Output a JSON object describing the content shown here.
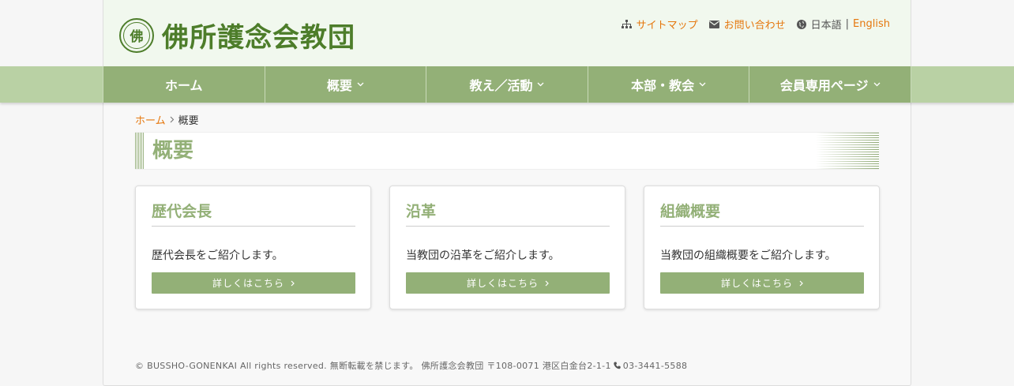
{
  "header": {
    "logo_seal": "佛",
    "logo_text": "佛所護念会教団",
    "links": {
      "sitemap": "サイトマップ",
      "contact": "お問い合わせ",
      "lang_ja": "日本語",
      "lang_sep": "|",
      "lang_en": "English"
    }
  },
  "nav": {
    "items": [
      {
        "label": "ホーム"
      },
      {
        "label": "概要"
      },
      {
        "label": "教え／活動"
      },
      {
        "label": "本部・教会"
      },
      {
        "label": "会員専用ページ"
      }
    ]
  },
  "breadcrumb": {
    "home": "ホーム",
    "current": "概要"
  },
  "page": {
    "title": "概要"
  },
  "cards": [
    {
      "title": "歴代会長",
      "text": "歴代会長をご紹介します。",
      "button": "詳しくはこちら"
    },
    {
      "title": "沿革",
      "text": "当教団の沿革をご紹介します。",
      "button": "詳しくはこちら"
    },
    {
      "title": "組織概要",
      "text": "当教団の組織概要をご紹介します。",
      "button": "詳しくはこちら"
    }
  ],
  "footer": {
    "copyright": "© BUSSHO-GONENKAI All rights reserved. 無断転載を禁じます。 佛所護念会教団 〒108-0071 港区白金台2-1-1",
    "phone": "03-3441-5588"
  },
  "colors": {
    "accent_green": "#93b077",
    "logo_green": "#4d7d2a",
    "link_orange": "#e5770d",
    "header_bg": "#f1f8ee"
  },
  "icons": {
    "sitemap": "sitemap-icon",
    "contact": "envelope-icon",
    "language": "globe-icon",
    "phone": "phone-icon"
  }
}
